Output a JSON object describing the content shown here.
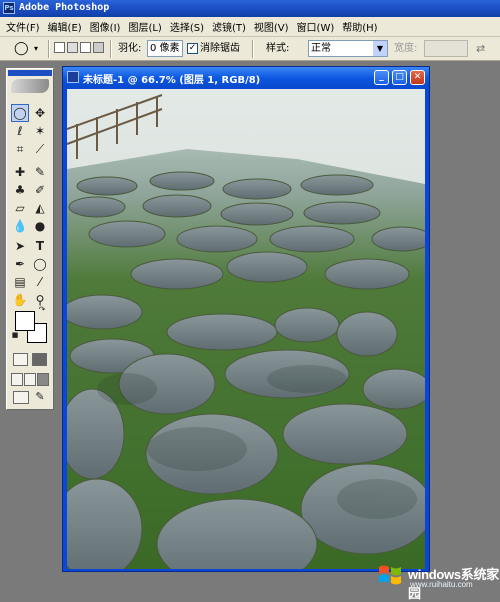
{
  "app": {
    "title": "Adobe Photoshop"
  },
  "menu": [
    "文件(F)",
    "编辑(E)",
    "图像(I)",
    "图层(L)",
    "选择(S)",
    "滤镜(T)",
    "视图(V)",
    "窗口(W)",
    "帮助(H)"
  ],
  "options": {
    "feather_label": "羽化:",
    "feather_value": "0 像素",
    "antialias_label": "消除锯齿",
    "style_label": "样式:",
    "style_value": "正常",
    "width_label": "宽度:"
  },
  "document": {
    "title": "未标题-1 @ 66.7% (图层 1, RGB/8)"
  },
  "watermark": {
    "brand": "windows系统家园",
    "url": "www.ruihaitu.com"
  },
  "colors": {
    "xp_blue": "#0a46d8",
    "panel": "#ece9d8",
    "workspace": "#7a7a7a"
  }
}
